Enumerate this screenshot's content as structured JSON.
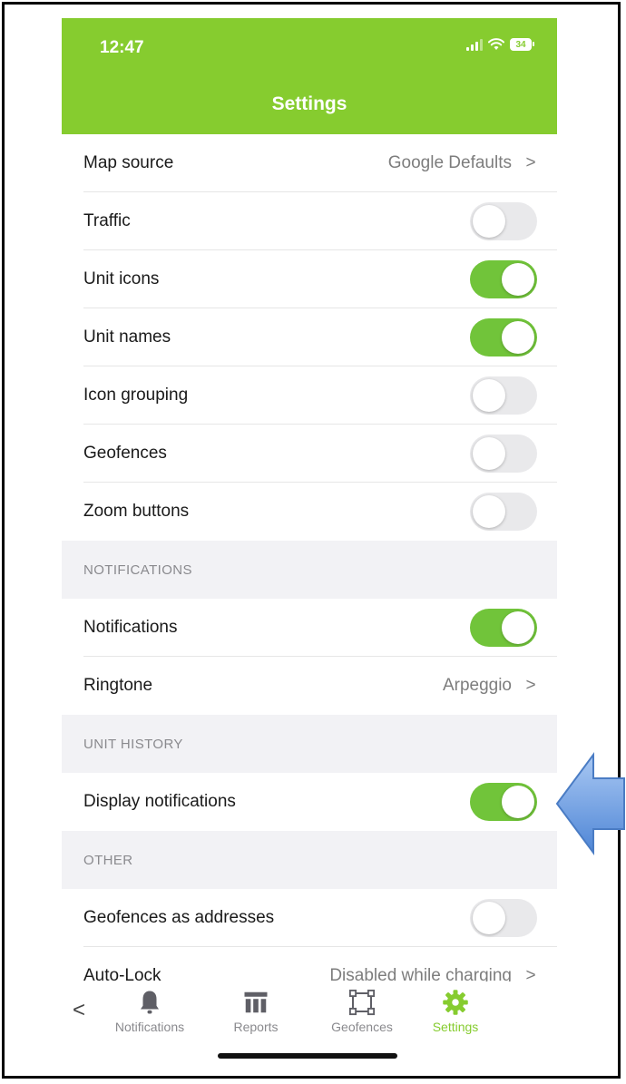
{
  "status": {
    "time": "12:47",
    "battery": "34"
  },
  "header": {
    "title": "Settings"
  },
  "map_section": {
    "map_source": {
      "label": "Map source",
      "value": "Google Defaults"
    },
    "traffic": {
      "label": "Traffic",
      "on": false
    },
    "unit_icons": {
      "label": "Unit icons",
      "on": true
    },
    "unit_names": {
      "label": "Unit names",
      "on": true
    },
    "icon_grouping": {
      "label": "Icon grouping",
      "on": false
    },
    "geofences": {
      "label": "Geofences",
      "on": false
    },
    "zoom_buttons": {
      "label": "Zoom buttons",
      "on": false
    }
  },
  "notifications_section": {
    "header": "NOTIFICATIONS",
    "notifications": {
      "label": "Notifications",
      "on": true
    },
    "ringtone": {
      "label": "Ringtone",
      "value": "Arpeggio"
    }
  },
  "unit_history_section": {
    "header": "UNIT HISTORY",
    "display_notifications": {
      "label": "Display notifications",
      "on": true
    }
  },
  "other_section": {
    "header": "OTHER",
    "geofences_as_addresses": {
      "label": "Geofences as addresses",
      "on": false
    },
    "auto_lock": {
      "label": "Auto-Lock",
      "value": "Disabled while charging"
    }
  },
  "chevron": ">",
  "back": "<",
  "tabbar": {
    "notifications": "Notifications",
    "reports": "Reports",
    "geofences": "Geofences",
    "settings": "Settings"
  },
  "colors": {
    "header": "#86cc2f",
    "toggle_on": "#71c43a",
    "toggle_off": "#e9e9eb",
    "arrow": "#6f9fe0"
  }
}
